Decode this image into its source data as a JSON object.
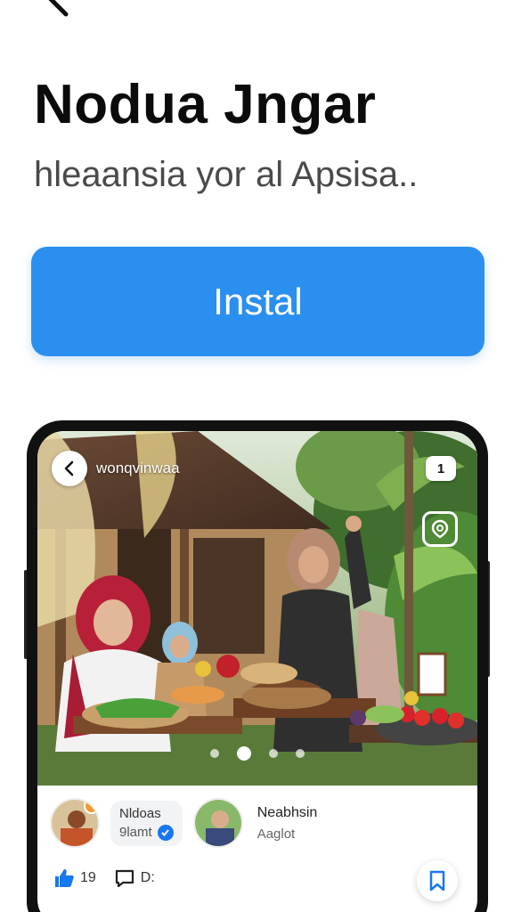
{
  "header": {
    "back_icon": "chevron-left-icon",
    "title": "Nodua Jngar",
    "subtitle": "hleaansia yor al Apsisa.."
  },
  "install": {
    "label": "Instal",
    "color": "#2b8ff0"
  },
  "preview": {
    "story_name": "wonqvinwaa",
    "badge_count": "1",
    "carousel": {
      "dots": 4,
      "active_index": 2
    },
    "chip": {
      "line1": "Nldoas",
      "line2": "9lamt"
    },
    "author": {
      "name": "Neabhsin",
      "subtitle": "Aaglot"
    },
    "actions": {
      "likes": "19",
      "comments": "D:"
    }
  },
  "colors": {
    "accent": "#2b8ff0",
    "verified": "#1877f2",
    "like": "#1877f2"
  }
}
